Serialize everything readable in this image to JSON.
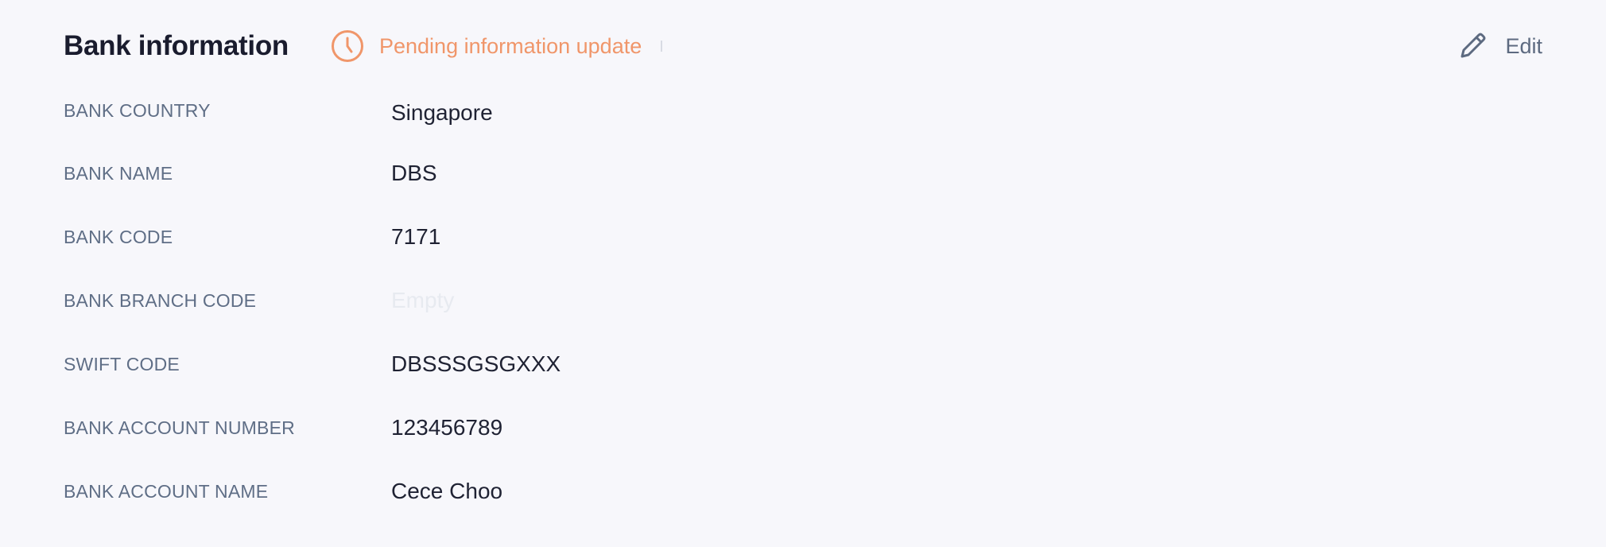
{
  "section": {
    "title": "Bank information",
    "pending_status": "Pending information update",
    "edit_label": "Edit"
  },
  "icons": {
    "pending": "clock-icon",
    "edit": "pencil-icon"
  },
  "colors": {
    "pending": "#f0966a",
    "label": "#5f6e86",
    "value": "#1f2233",
    "title": "#1a1c2e",
    "empty": "#e7eaf0"
  },
  "fields": [
    {
      "label": "BANK COUNTRY",
      "value": "Singapore"
    },
    {
      "label": "BANK NAME",
      "value": "DBS"
    },
    {
      "label": "BANK CODE",
      "value": "7171"
    },
    {
      "label": "BANK BRANCH CODE",
      "value": "Empty"
    },
    {
      "label": "SWIFT CODE",
      "value": "DBSSSGSGXXX"
    },
    {
      "label": "BANK ACCOUNT NUMBER",
      "value": "123456789"
    },
    {
      "label": "BANK ACCOUNT NAME",
      "value": "Cece Choo"
    }
  ]
}
